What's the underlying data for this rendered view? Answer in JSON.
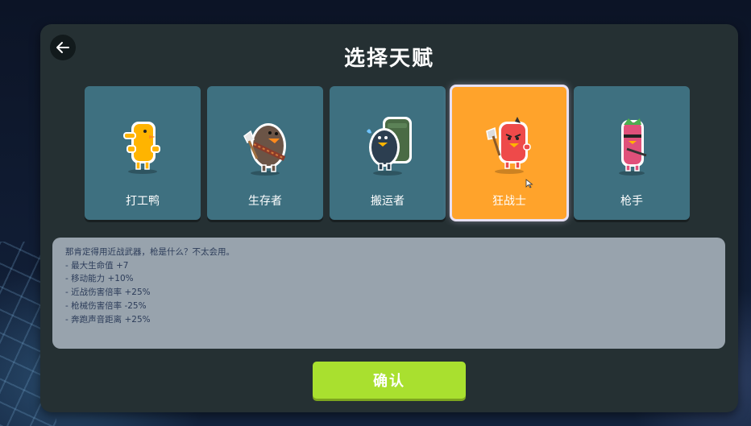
{
  "title": "选择天赋",
  "cards": [
    {
      "label": "打工鸭",
      "icon": "worker-duck-icon",
      "selected": false
    },
    {
      "label": "生存者",
      "icon": "survivor-icon",
      "selected": false
    },
    {
      "label": "搬运者",
      "icon": "porter-icon",
      "selected": false
    },
    {
      "label": "狂战士",
      "icon": "berserker-icon",
      "selected": true
    },
    {
      "label": "枪手",
      "icon": "gunner-icon",
      "selected": false
    }
  ],
  "description": {
    "lines": [
      "那肯定得用近战武器，枪是什么？不太会用。",
      "- 最大生命值 +7",
      "- 移动能力 +10%",
      "- 近战伤害倍率 +25%",
      "- 枪械伤害倍率 -25%",
      "- 奔跑声音距离 +25%"
    ]
  },
  "confirm_label": "确认",
  "colors": {
    "panel": "#253033",
    "card": "#3e7080",
    "card_selected": "#ffa32b",
    "description_bg": "#98a3ad",
    "confirm": "#a9e02f"
  }
}
